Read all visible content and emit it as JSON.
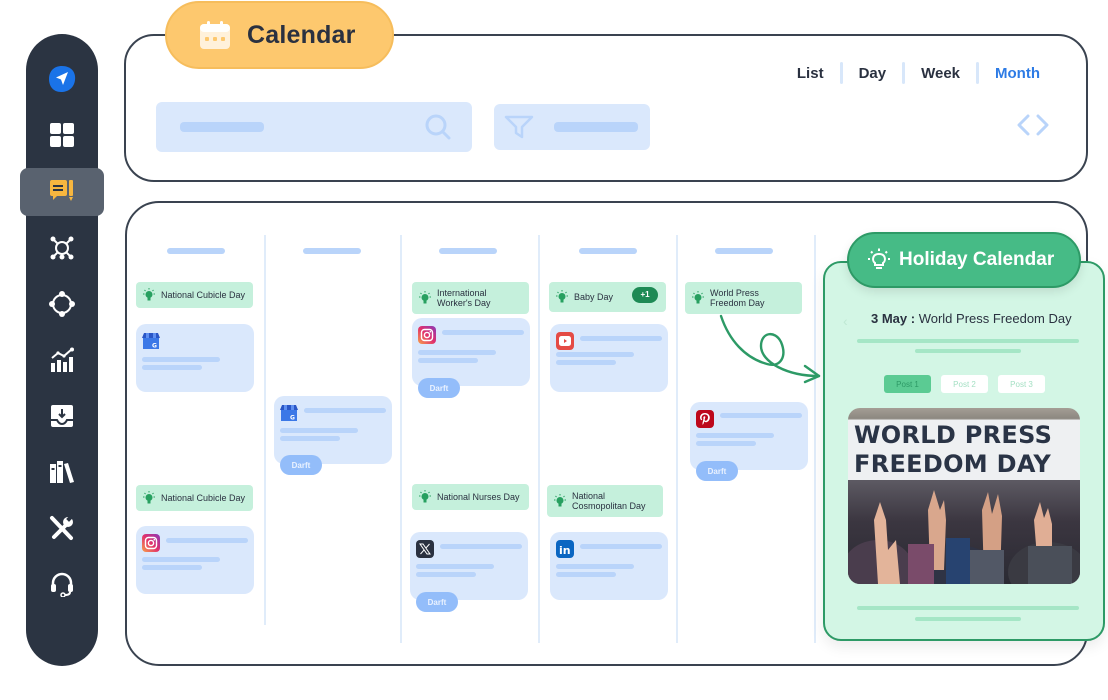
{
  "header": {
    "title": "Calendar",
    "title_icon": "calendar-icon",
    "view_tabs": [
      {
        "label": "List",
        "active": false
      },
      {
        "label": "Day",
        "active": false
      },
      {
        "label": "Week",
        "active": false
      },
      {
        "label": "Month",
        "active": true
      }
    ],
    "search_icon": "search-icon",
    "filter_icon": "filter-icon",
    "prev_icon": "chevron-left-icon",
    "next_icon": "chevron-right-icon"
  },
  "sidebar": {
    "items": [
      {
        "icon": "send-logo-icon",
        "active": false
      },
      {
        "icon": "dashboard-grid-icon",
        "active": false
      },
      {
        "icon": "compose-post-icon",
        "active": true
      },
      {
        "icon": "network-hub-icon",
        "active": false
      },
      {
        "icon": "connections-cycle-icon",
        "active": false
      },
      {
        "icon": "analytics-chart-icon",
        "active": false
      },
      {
        "icon": "inbox-download-icon",
        "active": false
      },
      {
        "icon": "library-books-icon",
        "active": false
      },
      {
        "icon": "tools-icon",
        "active": false
      },
      {
        "icon": "support-headset-icon",
        "active": false
      }
    ]
  },
  "calendar": {
    "holidays": [
      {
        "label": "National Cubicle Day",
        "col": 0,
        "row": 0
      },
      {
        "label": "International Worker's Day",
        "col": 2,
        "row": 0
      },
      {
        "label": "Baby Day",
        "col": 3,
        "row": 0,
        "badge": "+1"
      },
      {
        "label": "World Press Freedom Day",
        "col": 4,
        "row": 0
      },
      {
        "label": "National Cubicle Day",
        "col": 0,
        "row": 1
      },
      {
        "label": "National Nurses Day",
        "col": 2,
        "row": 1
      },
      {
        "label": "National Cosmopolitan Day",
        "col": 3,
        "row": 1
      }
    ],
    "posts": [
      {
        "network": "google-business",
        "col": 0,
        "status": ""
      },
      {
        "network": "google-business",
        "col": 1,
        "status": "Darft"
      },
      {
        "network": "instagram",
        "col": 2,
        "status": "Darft"
      },
      {
        "network": "youtube",
        "col": 3,
        "status": ""
      },
      {
        "network": "pinterest",
        "col": 4,
        "status": "Darft"
      },
      {
        "network": "instagram",
        "col": 0,
        "status": ""
      },
      {
        "network": "x-twitter",
        "col": 2,
        "status": "Darft"
      },
      {
        "network": "linkedin",
        "col": 3,
        "status": ""
      }
    ],
    "draft_label": "Darft"
  },
  "holiday_panel": {
    "title": "Holiday Calendar",
    "date": "3 May :",
    "holiday_name": "World Press Freedom Day",
    "tabs": [
      {
        "label": "Post 1",
        "active": true
      },
      {
        "label": "Post 2",
        "active": false
      },
      {
        "label": "Post 3",
        "active": false
      }
    ],
    "image_banner_line1": "WORLD PRESS",
    "image_banner_line2": "FREEDOM DAY"
  },
  "colors": {
    "accent_blue": "#2d7be5",
    "holiday_green": "#46bb86",
    "calendar_yellow": "#fdc86e",
    "sidebar_dark": "#2b3442"
  }
}
